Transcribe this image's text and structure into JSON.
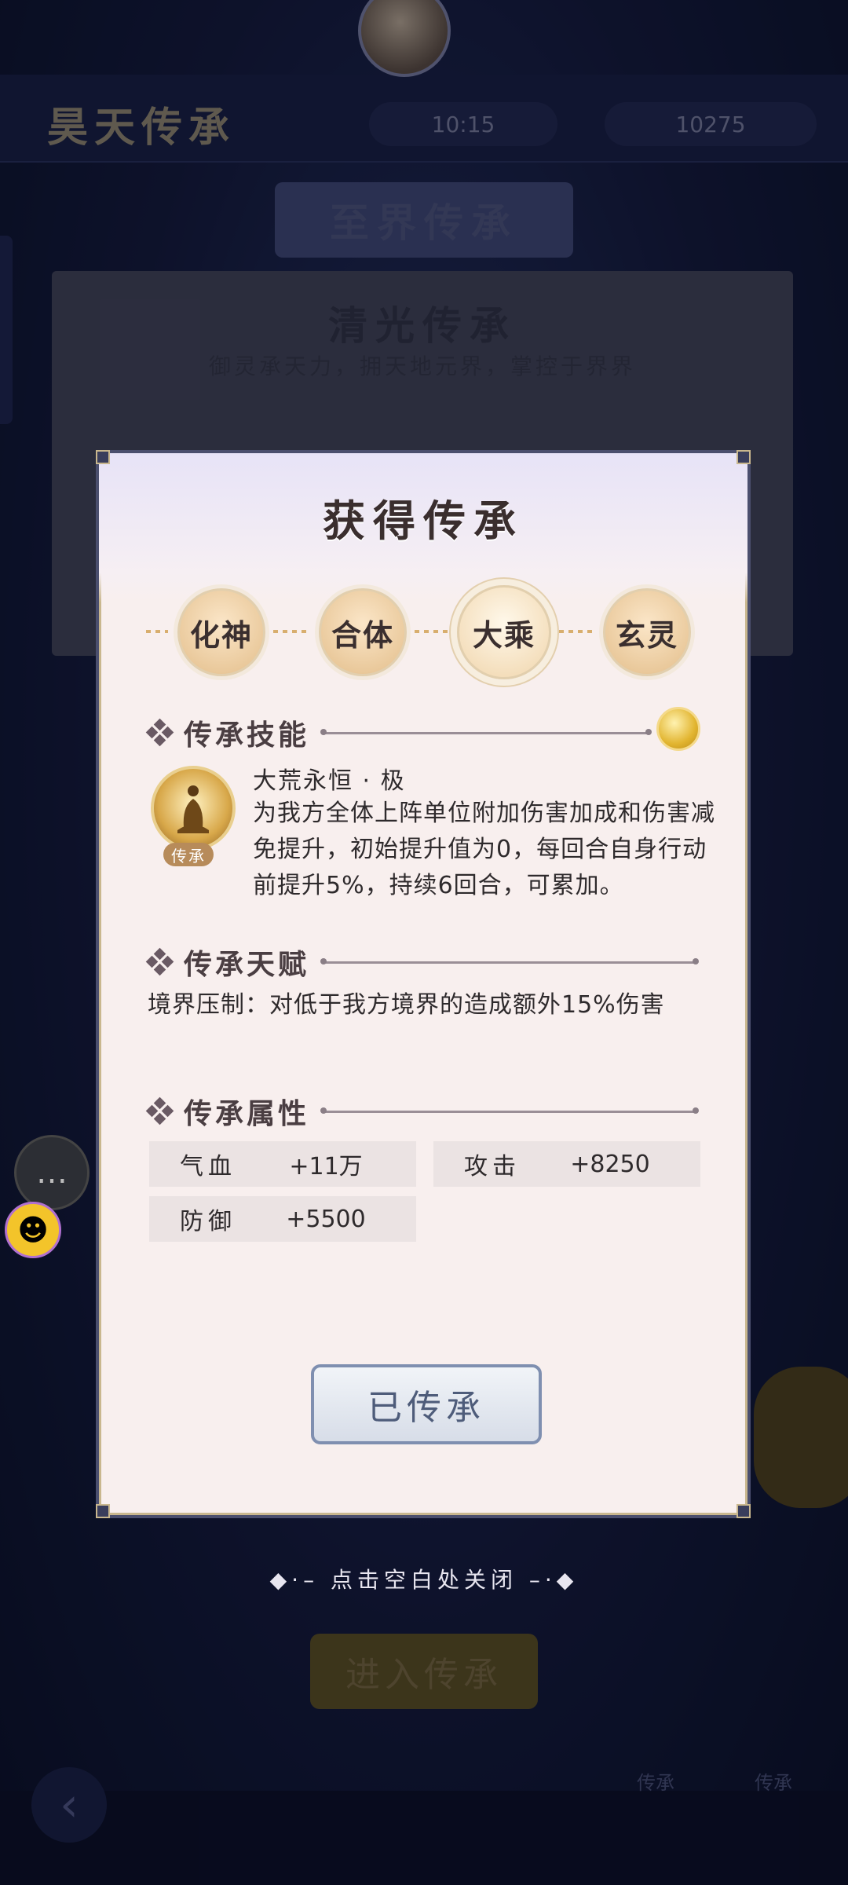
{
  "background": {
    "title": "昊天传承",
    "resource1": "10:15",
    "resource2": "10275",
    "banner": "至界传承",
    "card_title": "清光传承",
    "card_sub": "御灵承天力，拥天地元界，掌控于界界",
    "enter_button": "进入传承",
    "bottom_btn1": "传承",
    "bottom_btn2": "传承"
  },
  "modal": {
    "title": "获得传承",
    "stages": [
      "化神",
      "合体",
      "大乘",
      "玄灵"
    ],
    "active_stage": "大乘",
    "skill": {
      "section": "传承技能",
      "name": "大荒永恒 · 极",
      "badge": "传承",
      "description": "为我方全体上阵单位附加伤害加成和伤害减免提升，初始提升值为0，每回合自身行动前提升5%，持续6回合，可累加。"
    },
    "talent": {
      "section": "传承天赋",
      "text": "境界压制：对低于我方境界的造成额外15%伤害"
    },
    "attributes": {
      "section": "传承属性",
      "items": [
        {
          "name": "气血",
          "value": "+11万"
        },
        {
          "name": "攻击",
          "value": "+8250"
        },
        {
          "name": "防御",
          "value": "+5500"
        }
      ]
    },
    "button": "已传承"
  },
  "close_hint": "点击空白处关闭",
  "icons": {
    "chat": "chat-bubble-icon",
    "emoji": "emoji-face-icon",
    "coin": "coin-icon",
    "skill": "meditating-figure-icon"
  },
  "colors": {
    "modal_bg": "#f8efee",
    "stage_gold": "#e9c89a",
    "button_border": "#7f8fb0"
  }
}
